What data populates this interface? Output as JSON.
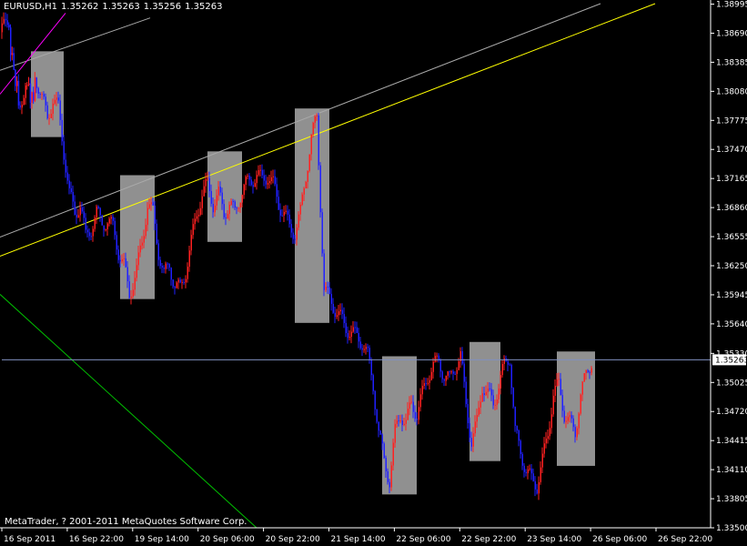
{
  "header": {
    "symbol": "EURUSD,H1",
    "open": "1.35262",
    "high": "1.35263",
    "low": "1.35256",
    "close": "1.35263"
  },
  "footer": {
    "copyright": "MetaTrader, ? 2001-2011 MetaQuotes Software Corp."
  },
  "colors": {
    "background": "#000000",
    "axis": "#ffffff",
    "bull": "#ff2020",
    "bear": "#2020ff",
    "box": "#a9a9a9",
    "trend_yellow": "#ffff00",
    "trend_grey": "#a9a9a9",
    "trend_green": "#00c000",
    "trend_magenta": "#ff00ff",
    "bid_line": "#8090c0"
  },
  "chart_data": {
    "type": "candlestick",
    "symbol": "EURUSD",
    "timeframe": "H1",
    "ylim": [
      1.335,
      1.39
    ],
    "y_ticks": [
      "1.38995",
      "1.38690",
      "1.38385",
      "1.38080",
      "1.37775",
      "1.37470",
      "1.37165",
      "1.36860",
      "1.36555",
      "1.36250",
      "1.35945",
      "1.35640",
      "1.35330",
      "1.35025",
      "1.34720",
      "1.34415",
      "1.34110",
      "1.33805",
      "1.33500"
    ],
    "x_ticks": [
      "16 Sep 2011",
      "16 Sep 22:00",
      "19 Sep 14:00",
      "20 Sep 06:00",
      "20 Sep 22:00",
      "21 Sep 14:00",
      "22 Sep 06:00",
      "22 Sep 22:00",
      "23 Sep 14:00",
      "26 Sep 06:00",
      "26 Sep 22:00"
    ],
    "current_price": "1.35263",
    "price_path": [
      [
        0,
        1.387
      ],
      [
        8,
        1.388
      ],
      [
        15,
        1.383
      ],
      [
        22,
        1.379
      ],
      [
        28,
        1.382
      ],
      [
        35,
        1.38
      ],
      [
        40,
        1.382
      ],
      [
        46,
        1.38
      ],
      [
        52,
        1.378
      ],
      [
        58,
        1.38
      ],
      [
        64,
        1.379
      ],
      [
        76,
        1.37
      ],
      [
        82,
        1.368
      ],
      [
        88,
        1.369
      ],
      [
        94,
        1.3655
      ],
      [
        100,
        1.3665
      ],
      [
        106,
        1.368
      ],
      [
        112,
        1.367
      ],
      [
        118,
        1.3672
      ],
      [
        124,
        1.3665
      ],
      [
        130,
        1.364
      ],
      [
        136,
        1.3625
      ],
      [
        142,
        1.3595
      ],
      [
        150,
        1.362
      ],
      [
        156,
        1.365
      ],
      [
        162,
        1.369
      ],
      [
        168,
        1.368
      ],
      [
        174,
        1.364
      ],
      [
        180,
        1.3615
      ],
      [
        186,
        1.3625
      ],
      [
        192,
        1.3605
      ],
      [
        198,
        1.36
      ],
      [
        204,
        1.362
      ],
      [
        210,
        1.365
      ],
      [
        216,
        1.368
      ],
      [
        222,
        1.37
      ],
      [
        228,
        1.371
      ],
      [
        234,
        1.369
      ],
      [
        240,
        1.37
      ],
      [
        246,
        1.368
      ],
      [
        252,
        1.369
      ],
      [
        258,
        1.368
      ],
      [
        264,
        1.37
      ],
      [
        270,
        1.371
      ],
      [
        276,
        1.3715
      ],
      [
        282,
        1.372
      ],
      [
        288,
        1.3715
      ],
      [
        294,
        1.372
      ],
      [
        300,
        1.371
      ],
      [
        306,
        1.369
      ],
      [
        312,
        1.368
      ],
      [
        318,
        1.3665
      ],
      [
        324,
        1.366
      ],
      [
        330,
        1.368
      ],
      [
        336,
        1.372
      ],
      [
        342,
        1.376
      ],
      [
        348,
        1.378
      ],
      [
        352,
        1.369
      ],
      [
        356,
        1.36
      ],
      [
        362,
        1.359
      ],
      [
        368,
        1.358
      ],
      [
        374,
        1.357
      ],
      [
        380,
        1.356
      ],
      [
        386,
        1.3555
      ],
      [
        392,
        1.355
      ],
      [
        398,
        1.3545
      ],
      [
        404,
        1.353
      ],
      [
        410,
        1.35
      ],
      [
        416,
        1.345
      ],
      [
        422,
        1.342
      ],
      [
        428,
        1.34
      ],
      [
        434,
        1.345
      ],
      [
        440,
        1.347
      ],
      [
        446,
        1.346
      ],
      [
        452,
        1.348
      ],
      [
        458,
        1.347
      ],
      [
        464,
        1.349
      ],
      [
        470,
        1.351
      ],
      [
        476,
        1.352
      ],
      [
        482,
        1.3525
      ],
      [
        488,
        1.351
      ],
      [
        494,
        1.3505
      ],
      [
        500,
        1.352
      ],
      [
        506,
        1.353
      ],
      [
        512,
        1.348
      ],
      [
        518,
        1.344
      ],
      [
        524,
        1.346
      ],
      [
        530,
        1.35
      ],
      [
        536,
        1.349
      ],
      [
        542,
        1.348
      ],
      [
        548,
        1.35
      ],
      [
        554,
        1.352
      ],
      [
        560,
        1.353
      ],
      [
        566,
        1.345
      ],
      [
        572,
        1.343
      ],
      [
        578,
        1.341
      ],
      [
        584,
        1.34
      ],
      [
        590,
        1.3395
      ],
      [
        596,
        1.342
      ],
      [
        602,
        1.345
      ],
      [
        608,
        1.349
      ],
      [
        614,
        1.35
      ],
      [
        620,
        1.347
      ],
      [
        626,
        1.346
      ],
      [
        632,
        1.345
      ],
      [
        638,
        1.349
      ],
      [
        644,
        1.351
      ],
      [
        650,
        1.3526
      ]
    ],
    "boxes": [
      {
        "start": 34,
        "end": 70,
        "low": 1.376,
        "high": 1.385
      },
      {
        "start": 132,
        "end": 170,
        "low": 1.359,
        "high": 1.372
      },
      {
        "start": 228,
        "end": 266,
        "low": 1.365,
        "high": 1.3745
      },
      {
        "start": 324,
        "end": 362,
        "low": 1.3565,
        "high": 1.379
      },
      {
        "start": 420,
        "end": 458,
        "low": 1.3385,
        "high": 1.353
      },
      {
        "start": 516,
        "end": 550,
        "low": 1.342,
        "high": 1.3545
      },
      {
        "start": 612,
        "end": 654,
        "low": 1.3415,
        "high": 1.3535
      }
    ],
    "trendlines": [
      {
        "color_key": "trend_yellow",
        "x1": 0,
        "y1": 1.3635,
        "x2": 720,
        "y2": 1.39
      },
      {
        "color_key": "trend_grey",
        "x1": 0,
        "y1": 1.3655,
        "x2": 660,
        "y2": 1.39
      },
      {
        "color_key": "trend_grey",
        "x1": 0,
        "y1": 1.383,
        "x2": 165,
        "y2": 1.3885
      },
      {
        "color_key": "trend_magenta",
        "x1": 0,
        "y1": 1.3805,
        "x2": 72,
        "y2": 1.389
      },
      {
        "color_key": "trend_green",
        "x1": 0,
        "y1": 1.3595,
        "x2": 282,
        "y2": 1.335
      }
    ]
  }
}
